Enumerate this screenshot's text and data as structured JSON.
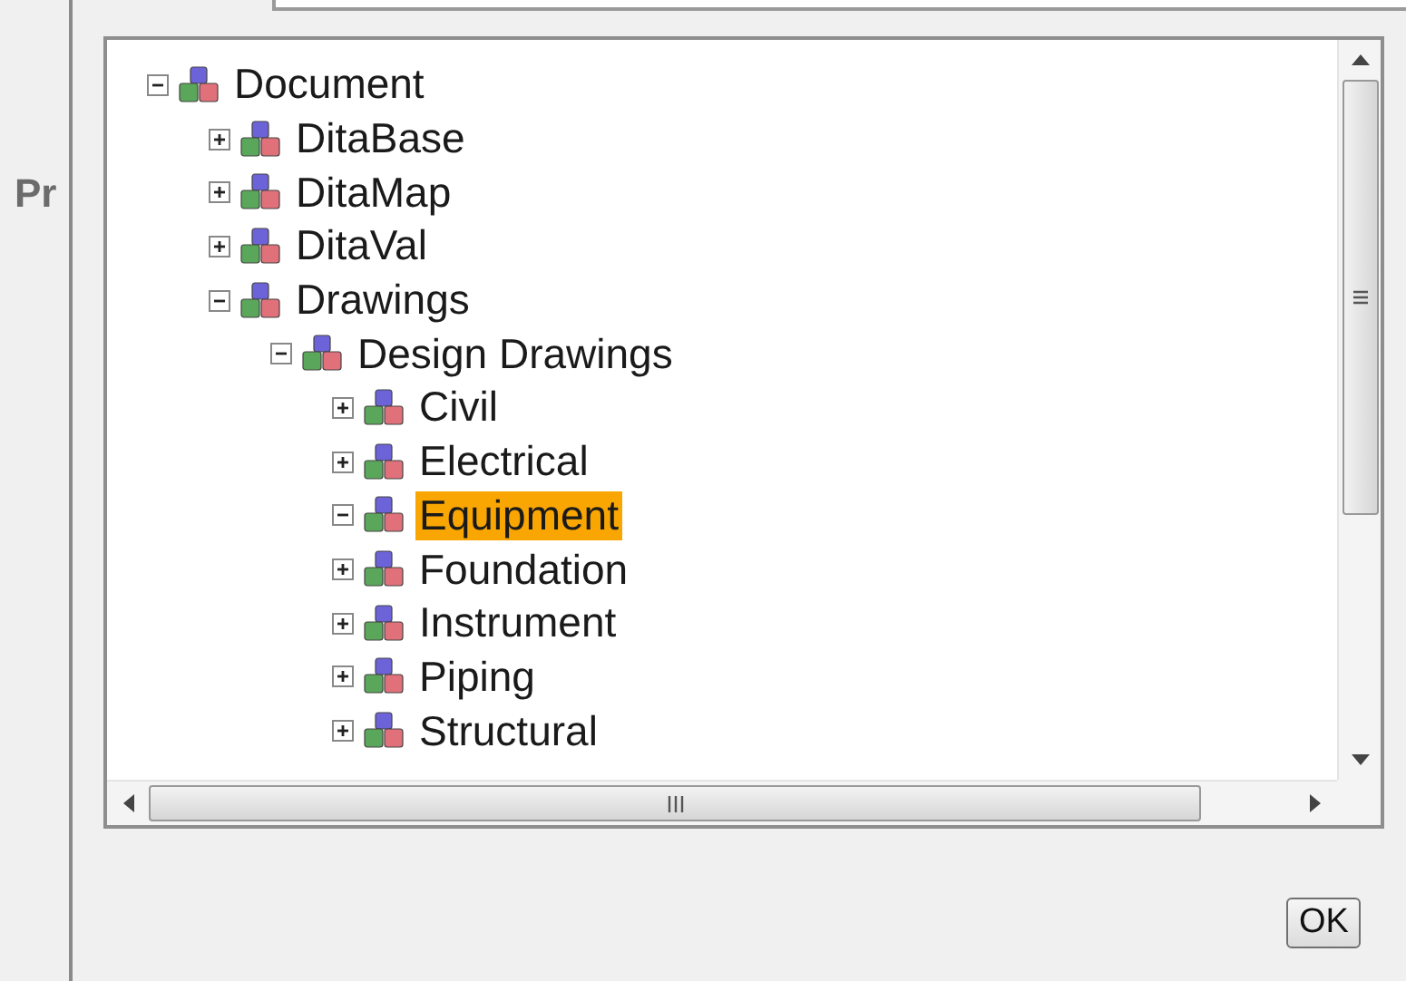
{
  "side_label": "Pr",
  "tree": [
    {
      "label": "Document",
      "expanded": true,
      "selected": false,
      "children": [
        {
          "label": "DitaBase",
          "expanded": false,
          "selected": false
        },
        {
          "label": "DitaMap",
          "expanded": false,
          "selected": false
        },
        {
          "label": "DitaVal",
          "expanded": false,
          "selected": false
        },
        {
          "label": "Drawings",
          "expanded": true,
          "selected": false,
          "children": [
            {
              "label": "Design Drawings",
              "expanded": true,
              "selected": false,
              "children": [
                {
                  "label": "Civil",
                  "expanded": false,
                  "selected": false
                },
                {
                  "label": "Electrical",
                  "expanded": false,
                  "selected": false
                },
                {
                  "label": "Equipment",
                  "expanded": true,
                  "selected": true
                },
                {
                  "label": "Foundation",
                  "expanded": false,
                  "selected": false
                },
                {
                  "label": "Instrument",
                  "expanded": false,
                  "selected": false
                },
                {
                  "label": "Piping",
                  "expanded": false,
                  "selected": false
                },
                {
                  "label": "Structural",
                  "expanded": false,
                  "selected": false
                }
              ]
            }
          ]
        }
      ]
    }
  ],
  "ok_button": "OK"
}
